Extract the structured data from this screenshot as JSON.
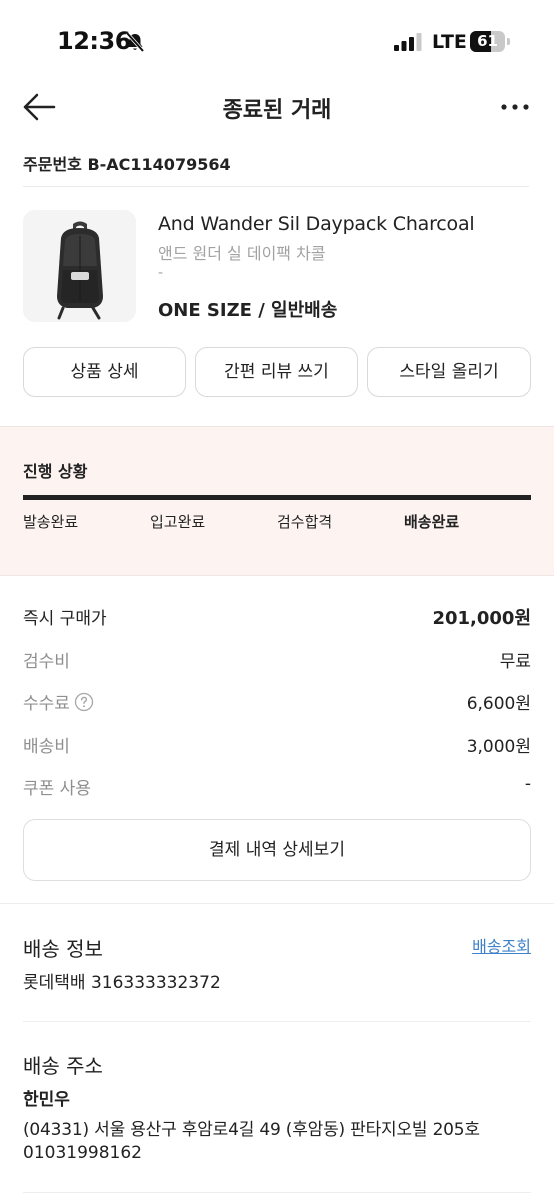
{
  "status_bar": {
    "time": "12:36",
    "network": "LTE",
    "battery_level": "61",
    "battery_fraction": 0.61
  },
  "header": {
    "title": "종료된 거래"
  },
  "order": {
    "number_label": "주문번호 B-AC114079564"
  },
  "product": {
    "name_en": "And Wander Sil Daypack Charcoal",
    "name_ko": "앤드 원더 실 데이팩 차콜",
    "extra": "-",
    "option": "ONE SIZE / 일반배송"
  },
  "actions": {
    "detail": "상품 상세",
    "review": "간편 리뷰 쓰기",
    "style": "스타일 올리기"
  },
  "progress": {
    "title": "진행 상황",
    "completed_fraction": 1.0,
    "steps": [
      "발송완료",
      "입고완료",
      "검수합격",
      "배송완료"
    ],
    "current_step_index": 3
  },
  "pricing": {
    "rows": [
      {
        "label": "즉시 구매가",
        "value": "201,000원"
      },
      {
        "label": "검수비",
        "value": "무료"
      },
      {
        "label": "수수료",
        "value": "6,600원"
      },
      {
        "label": "배송비",
        "value": "3,000원"
      },
      {
        "label": "쿠폰 사용",
        "value": "-"
      }
    ],
    "detail_button": "결제 내역 상세보기"
  },
  "shipping_info": {
    "title": "배송 정보",
    "tracking_link": "배송조회",
    "carrier": "롯데택배 316333332372"
  },
  "shipping_address": {
    "title": "배송 주소",
    "name": "한민우",
    "address": "(04331) 서울 용산구 후암로4길 49 (후암동) 판타지오빌 205호",
    "phone": "01031998162"
  },
  "colors": {
    "progress_bg": "#fdf4f2",
    "link": "#3f82c9",
    "muted_text": "#8f8f8f"
  }
}
